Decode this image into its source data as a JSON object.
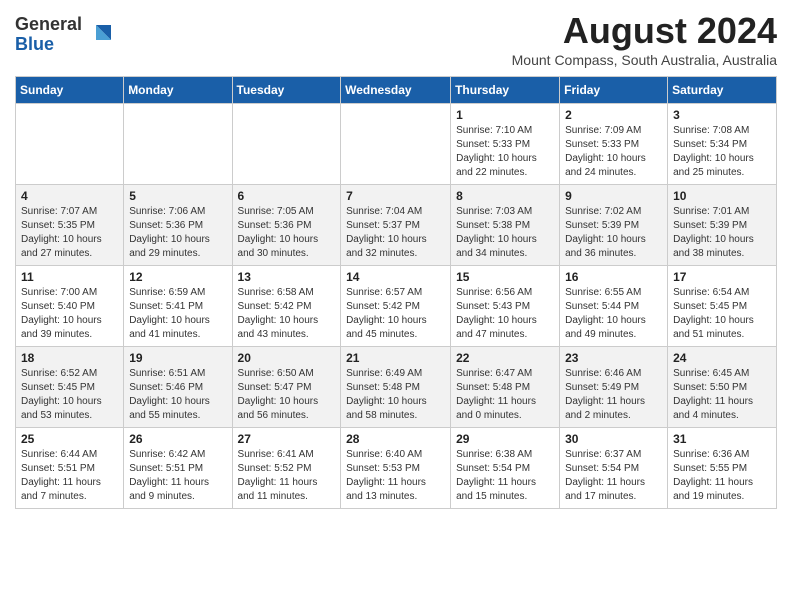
{
  "logo": {
    "general": "General",
    "blue": "Blue"
  },
  "title": {
    "month_year": "August 2024",
    "location": "Mount Compass, South Australia, Australia"
  },
  "weekdays": [
    "Sunday",
    "Monday",
    "Tuesday",
    "Wednesday",
    "Thursday",
    "Friday",
    "Saturday"
  ],
  "weeks": [
    [
      {
        "day": "",
        "info": ""
      },
      {
        "day": "",
        "info": ""
      },
      {
        "day": "",
        "info": ""
      },
      {
        "day": "",
        "info": ""
      },
      {
        "day": "1",
        "info": "Sunrise: 7:10 AM\nSunset: 5:33 PM\nDaylight: 10 hours\nand 22 minutes."
      },
      {
        "day": "2",
        "info": "Sunrise: 7:09 AM\nSunset: 5:33 PM\nDaylight: 10 hours\nand 24 minutes."
      },
      {
        "day": "3",
        "info": "Sunrise: 7:08 AM\nSunset: 5:34 PM\nDaylight: 10 hours\nand 25 minutes."
      }
    ],
    [
      {
        "day": "4",
        "info": "Sunrise: 7:07 AM\nSunset: 5:35 PM\nDaylight: 10 hours\nand 27 minutes."
      },
      {
        "day": "5",
        "info": "Sunrise: 7:06 AM\nSunset: 5:36 PM\nDaylight: 10 hours\nand 29 minutes."
      },
      {
        "day": "6",
        "info": "Sunrise: 7:05 AM\nSunset: 5:36 PM\nDaylight: 10 hours\nand 30 minutes."
      },
      {
        "day": "7",
        "info": "Sunrise: 7:04 AM\nSunset: 5:37 PM\nDaylight: 10 hours\nand 32 minutes."
      },
      {
        "day": "8",
        "info": "Sunrise: 7:03 AM\nSunset: 5:38 PM\nDaylight: 10 hours\nand 34 minutes."
      },
      {
        "day": "9",
        "info": "Sunrise: 7:02 AM\nSunset: 5:39 PM\nDaylight: 10 hours\nand 36 minutes."
      },
      {
        "day": "10",
        "info": "Sunrise: 7:01 AM\nSunset: 5:39 PM\nDaylight: 10 hours\nand 38 minutes."
      }
    ],
    [
      {
        "day": "11",
        "info": "Sunrise: 7:00 AM\nSunset: 5:40 PM\nDaylight: 10 hours\nand 39 minutes."
      },
      {
        "day": "12",
        "info": "Sunrise: 6:59 AM\nSunset: 5:41 PM\nDaylight: 10 hours\nand 41 minutes."
      },
      {
        "day": "13",
        "info": "Sunrise: 6:58 AM\nSunset: 5:42 PM\nDaylight: 10 hours\nand 43 minutes."
      },
      {
        "day": "14",
        "info": "Sunrise: 6:57 AM\nSunset: 5:42 PM\nDaylight: 10 hours\nand 45 minutes."
      },
      {
        "day": "15",
        "info": "Sunrise: 6:56 AM\nSunset: 5:43 PM\nDaylight: 10 hours\nand 47 minutes."
      },
      {
        "day": "16",
        "info": "Sunrise: 6:55 AM\nSunset: 5:44 PM\nDaylight: 10 hours\nand 49 minutes."
      },
      {
        "day": "17",
        "info": "Sunrise: 6:54 AM\nSunset: 5:45 PM\nDaylight: 10 hours\nand 51 minutes."
      }
    ],
    [
      {
        "day": "18",
        "info": "Sunrise: 6:52 AM\nSunset: 5:45 PM\nDaylight: 10 hours\nand 53 minutes."
      },
      {
        "day": "19",
        "info": "Sunrise: 6:51 AM\nSunset: 5:46 PM\nDaylight: 10 hours\nand 55 minutes."
      },
      {
        "day": "20",
        "info": "Sunrise: 6:50 AM\nSunset: 5:47 PM\nDaylight: 10 hours\nand 56 minutes."
      },
      {
        "day": "21",
        "info": "Sunrise: 6:49 AM\nSunset: 5:48 PM\nDaylight: 10 hours\nand 58 minutes."
      },
      {
        "day": "22",
        "info": "Sunrise: 6:47 AM\nSunset: 5:48 PM\nDaylight: 11 hours\nand 0 minutes."
      },
      {
        "day": "23",
        "info": "Sunrise: 6:46 AM\nSunset: 5:49 PM\nDaylight: 11 hours\nand 2 minutes."
      },
      {
        "day": "24",
        "info": "Sunrise: 6:45 AM\nSunset: 5:50 PM\nDaylight: 11 hours\nand 4 minutes."
      }
    ],
    [
      {
        "day": "25",
        "info": "Sunrise: 6:44 AM\nSunset: 5:51 PM\nDaylight: 11 hours\nand 7 minutes."
      },
      {
        "day": "26",
        "info": "Sunrise: 6:42 AM\nSunset: 5:51 PM\nDaylight: 11 hours\nand 9 minutes."
      },
      {
        "day": "27",
        "info": "Sunrise: 6:41 AM\nSunset: 5:52 PM\nDaylight: 11 hours\nand 11 minutes."
      },
      {
        "day": "28",
        "info": "Sunrise: 6:40 AM\nSunset: 5:53 PM\nDaylight: 11 hours\nand 13 minutes."
      },
      {
        "day": "29",
        "info": "Sunrise: 6:38 AM\nSunset: 5:54 PM\nDaylight: 11 hours\nand 15 minutes."
      },
      {
        "day": "30",
        "info": "Sunrise: 6:37 AM\nSunset: 5:54 PM\nDaylight: 11 hours\nand 17 minutes."
      },
      {
        "day": "31",
        "info": "Sunrise: 6:36 AM\nSunset: 5:55 PM\nDaylight: 11 hours\nand 19 minutes."
      }
    ]
  ]
}
